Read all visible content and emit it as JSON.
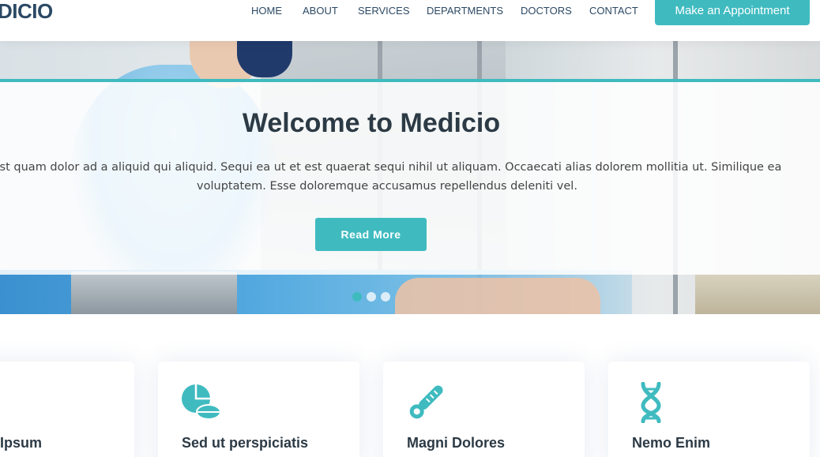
{
  "brand": {
    "logo_text": "DICIO",
    "accent": "#3fbbc0",
    "heading": "#2c4964"
  },
  "nav": {
    "items": [
      {
        "label": "HOME"
      },
      {
        "label": "ABOUT"
      },
      {
        "label": "SERVICES"
      },
      {
        "label": "DEPARTMENTS"
      },
      {
        "label": "DOCTORS"
      },
      {
        "label": "CONTACT"
      }
    ],
    "cta_label": "Make an Appointment"
  },
  "hero": {
    "title": "Welcome to Medicio",
    "text": "est quam dolor ad a aliquid qui aliquid. Sequi ea ut et est quaerat sequi nihil ut aliquam. Occaecati alias dolorem mollitia ut. Similique ea voluptatem. Esse doloremque accusamus repellendus deleniti vel.",
    "button_label": "Read More",
    "slides": 3,
    "active_slide": 1
  },
  "services": {
    "cards": [
      {
        "title": "Ipsum",
        "icon": "heartbeat-icon"
      },
      {
        "title": "Sed ut perspiciatis",
        "icon": "pills-icon"
      },
      {
        "title": "Magni Dolores",
        "icon": "thermometer-icon"
      },
      {
        "title": "Nemo Enim",
        "icon": "dna-icon"
      }
    ]
  }
}
